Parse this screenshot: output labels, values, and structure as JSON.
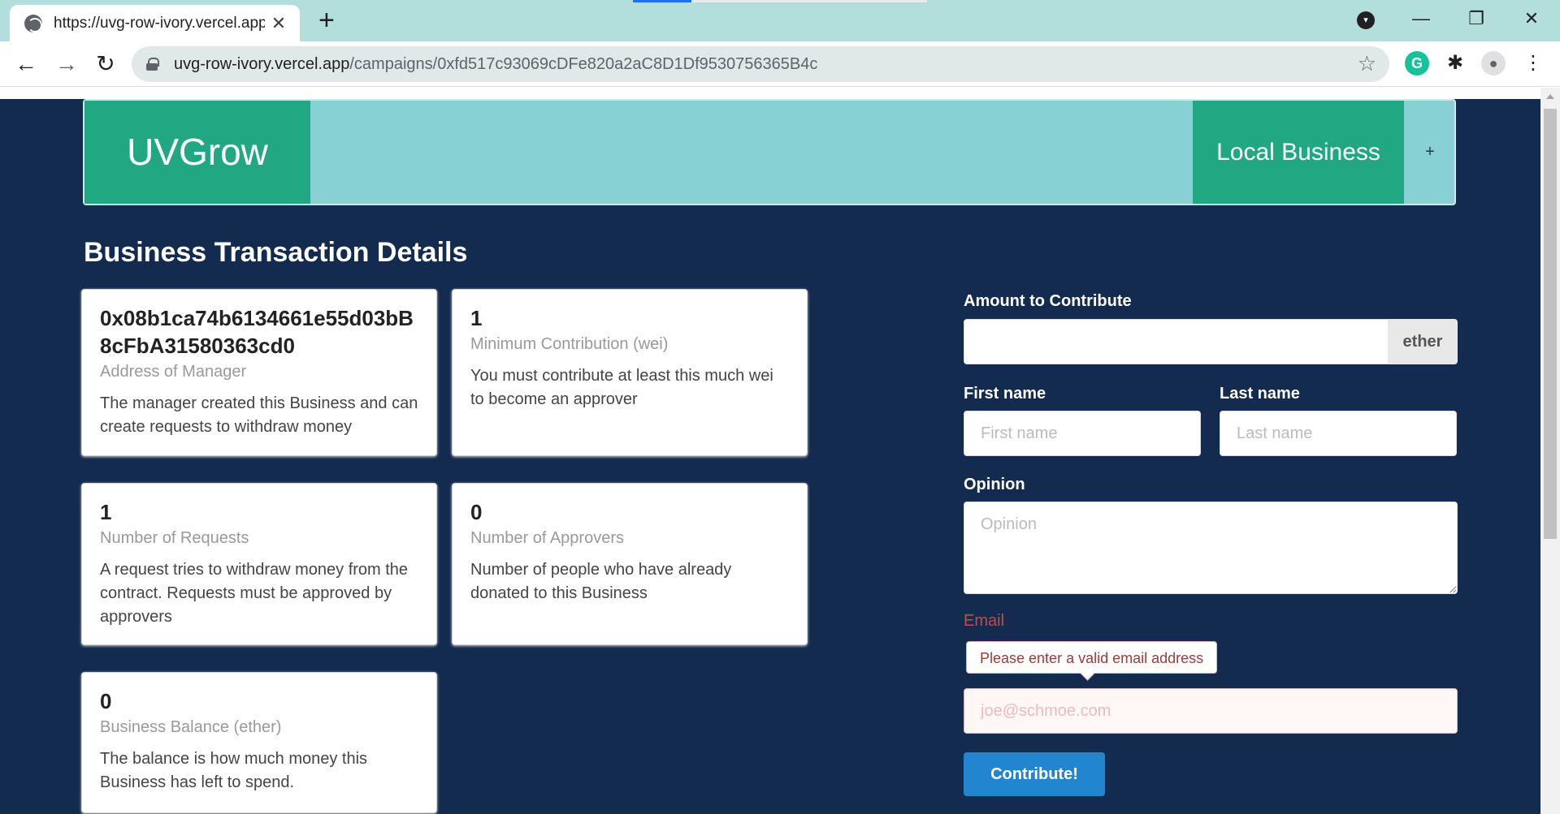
{
  "browser": {
    "tab_title": "https://uvg-row-ivory.vercel.app/",
    "tab_close": "✕",
    "new_tab": "+",
    "url_host": "uvg-row-ivory.vercel.app",
    "url_path": "/campaigns/0xfd517c93069cDFe820a2aC8D1Df9530756365B4c",
    "window": {
      "minimize": "—",
      "maximize": "❐",
      "close": "✕"
    }
  },
  "nav": {
    "brand": "UVGrow",
    "right_item": "Local Business",
    "plus": "+"
  },
  "page_title": "Business Transaction Details",
  "cards": [
    {
      "value": "0x08b1ca74b6134661e55d03bB8cFbA31580363cd0",
      "meta": "Address of Manager",
      "desc": "The manager created this Business and can create requests to withdraw money"
    },
    {
      "value": "1",
      "meta": "Minimum Contribution (wei)",
      "desc": "You must contribute at least this much wei to become an approver"
    },
    {
      "value": "1",
      "meta": "Number of Requests",
      "desc": "A request tries to withdraw money from the contract. Requests must be approved by approvers"
    },
    {
      "value": "0",
      "meta": "Number of Approvers",
      "desc": "Number of people who have already donated to this Business"
    },
    {
      "value": "0",
      "meta": "Business Balance (ether)",
      "desc": "The balance is how much money this Business has left to spend."
    }
  ],
  "form": {
    "amount_label": "Amount to Contribute",
    "amount_value": "",
    "amount_unit": "ether",
    "first_name_label": "First name",
    "first_name_placeholder": "First name",
    "last_name_label": "Last name",
    "last_name_placeholder": "Last name",
    "opinion_label": "Opinion",
    "opinion_placeholder": "Opinion",
    "email_label": "Email",
    "email_error": "Please enter a valid email address",
    "email_placeholder": "joe@schmoe.com",
    "submit_label": "Contribute!"
  },
  "colors": {
    "page_bg": "#122b4f",
    "nav_bg": "#87d0d3",
    "brand_green": "#21a882",
    "button_blue": "#2185d0",
    "error_red": "#9f3a38"
  }
}
